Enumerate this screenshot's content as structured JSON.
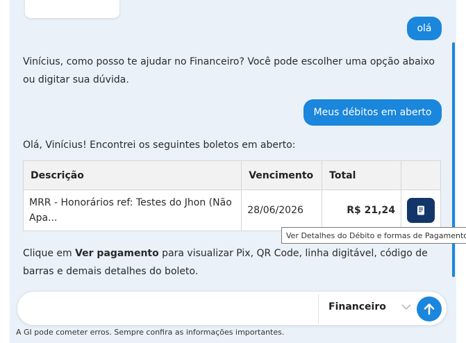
{
  "chat": {
    "user_msg_1": "olá",
    "bot_msg_1": "Vinícius, como posso te ajudar no Financeiro? Você pode escolher uma opção abaixo ou digitar sua dúvida.",
    "user_msg_2": "Meus débitos em aberto",
    "bot_msg_2": "Olá, Vinícius! Encontrei os seguintes boletos em aberto:",
    "bot_msg_3_pre": "Clique em ",
    "bot_msg_3_bold": "Ver pagamento",
    "bot_msg_3_post": " para visualizar Pix, QR Code, linha digitável, código de barras e demais detalhes do boleto."
  },
  "table": {
    "headers": [
      "Descrição",
      "Vencimento",
      "Total",
      ""
    ],
    "rows": [
      {
        "descricao": "MRR - Honorários ref: Testes do Jhon (Não Apa...",
        "vencimento": "28/06/2026",
        "total": "R$ 21,24",
        "action_icon": "document-icon"
      }
    ]
  },
  "tooltip": "Ver Detalhes do Débito e formas de Pagamento",
  "input": {
    "placeholder": "",
    "department": "Financeiro",
    "send_icon": "arrow-up-icon"
  },
  "disclaimer": "A GI pode cometer erros. Sempre confira as informações importantes.",
  "colors": {
    "accent": "#1a86dc",
    "dark_button": "#13366a",
    "background": "#eaf1f9"
  }
}
